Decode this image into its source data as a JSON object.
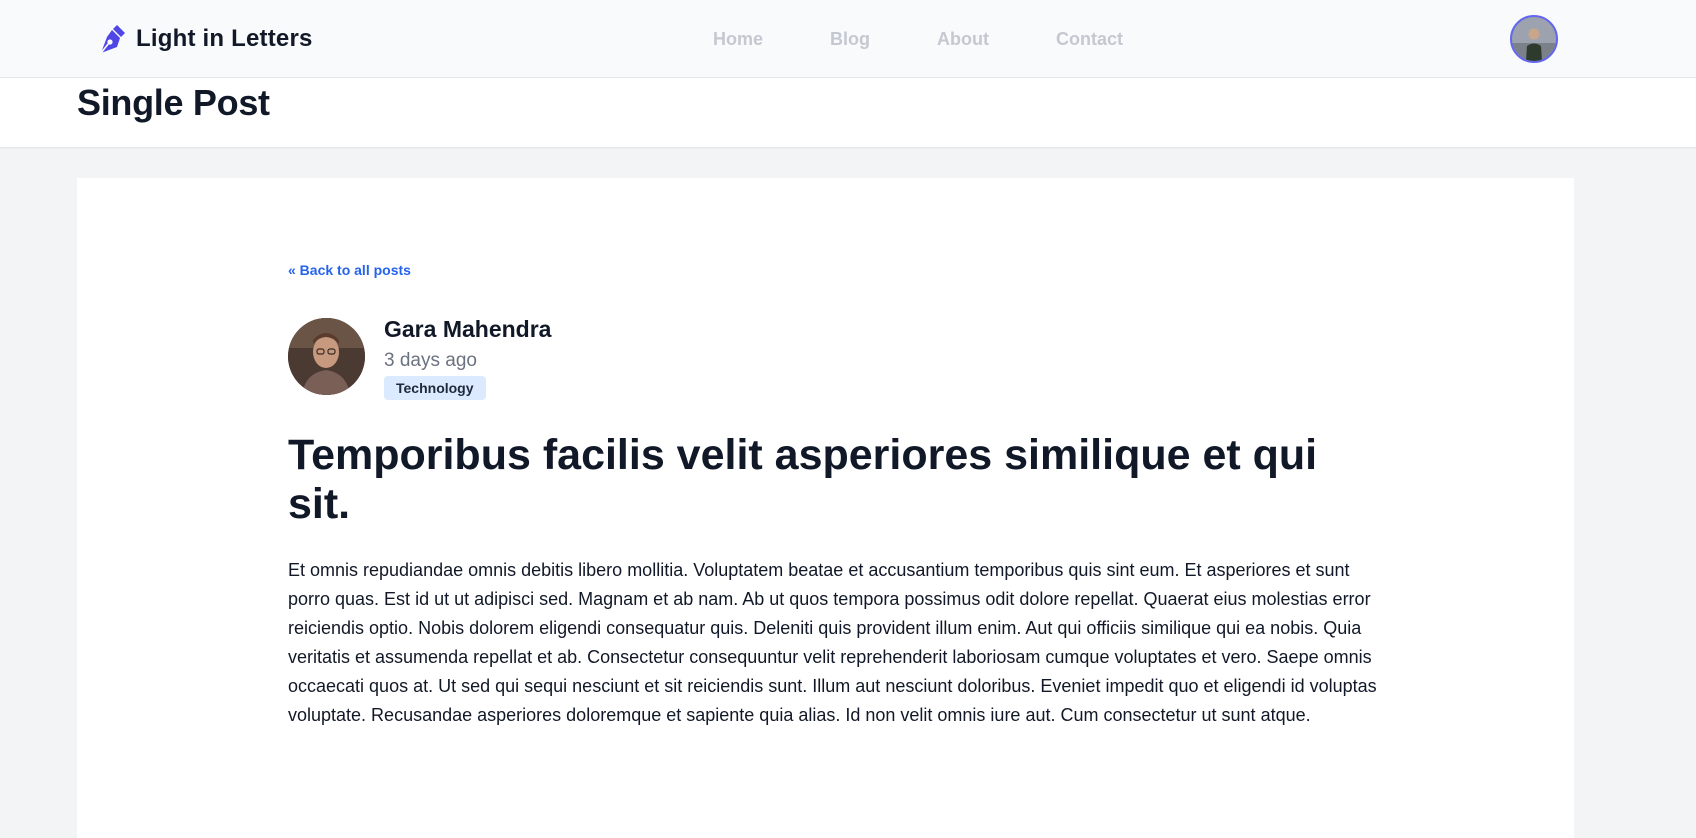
{
  "brand": {
    "name": "Light in Letters",
    "icon": "pen-nib-icon",
    "color": "#4f46e5"
  },
  "nav": {
    "links": [
      {
        "label": "Home"
      },
      {
        "label": "Blog"
      },
      {
        "label": "About"
      },
      {
        "label": "Contact"
      }
    ],
    "user_avatar": "user-avatar"
  },
  "header": {
    "title": "Single Post"
  },
  "post": {
    "back_label": "« Back to all posts",
    "author": {
      "name": "Gara Mahendra",
      "avatar": "author-avatar"
    },
    "time_ago": "3 days ago",
    "category": "Technology",
    "title": "Temporibus facilis velit asperiores similique et qui sit.",
    "body": "Et omnis repudiandae omnis debitis libero mollitia. Voluptatem beatae et accusantium temporibus quis sint eum. Et asperiores et sunt porro quas. Est id ut ut adipisci sed. Magnam et ab nam. Ab ut quos tempora possimus odit dolore repellat. Quaerat eius molestias error reiciendis optio. Nobis dolorem eligendi consequatur quis. Deleniti quis provident illum enim. Aut qui officiis similique qui ea nobis. Quia veritatis et assumenda repellat et ab. Consectetur consequuntur velit reprehenderit laboriosam cumque voluptates et vero. Saepe omnis occaecati quos at. Ut sed qui sequi nesciunt et sit reiciendis sunt. Illum aut nesciunt doloribus. Eveniet impedit quo et eligendi id voluptas voluptate. Recusandae asperiores doloremque et sapiente quia alias. Id non velit omnis iure aut. Cum consectetur ut sunt atque."
  },
  "colors": {
    "accent": "#4f46e5",
    "link": "#2563eb",
    "badge_bg": "#dbeafe",
    "page_bg": "#f3f4f6"
  }
}
